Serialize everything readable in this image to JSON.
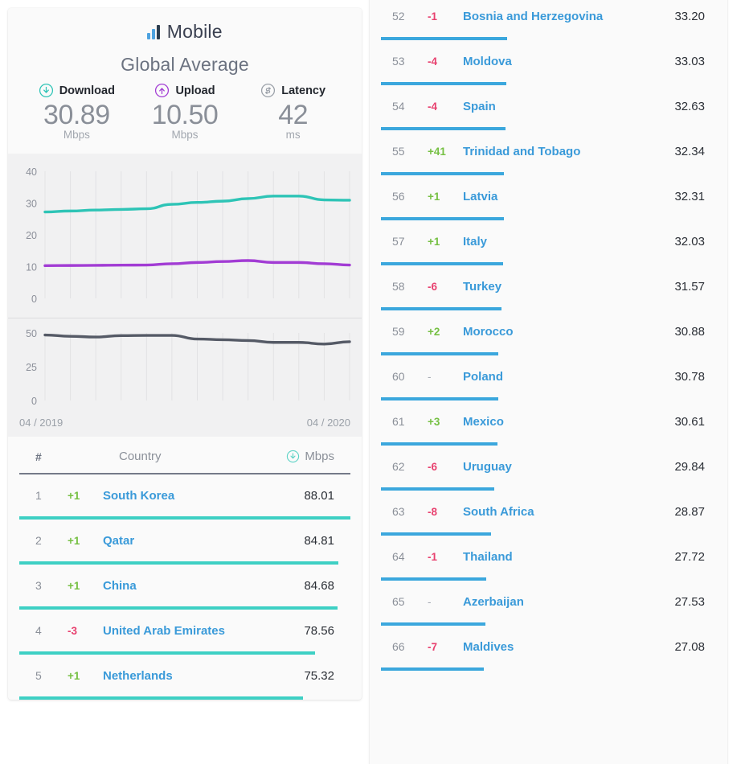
{
  "card": {
    "title": "Mobile",
    "title_icon": "bar-chart-icon",
    "subtitle": "Global Average",
    "metrics": [
      {
        "icon": "download-circle-icon",
        "name": "Download",
        "value": "30.89",
        "unit": "Mbps",
        "color": "#2ec4b6"
      },
      {
        "icon": "upload-circle-icon",
        "name": "Upload",
        "value": "10.50",
        "unit": "Mbps",
        "color": "#a23cd4"
      },
      {
        "icon": "latency-circle-icon",
        "name": "Latency",
        "value": "42",
        "unit": "ms",
        "color": "#8c909a"
      }
    ],
    "date_start": "04 / 2019",
    "date_end": "04 / 2020"
  },
  "chart_data": [
    {
      "type": "line",
      "title": "Global Average Speed",
      "xlabel": "",
      "ylabel": "Mbps",
      "ylim": [
        0,
        40
      ],
      "yticks": [
        0,
        10,
        20,
        30,
        40
      ],
      "grid": true,
      "legend": "none",
      "x": [
        "04/2019",
        "05/2019",
        "06/2019",
        "07/2019",
        "08/2019",
        "09/2019",
        "10/2019",
        "11/2019",
        "12/2019",
        "01/2020",
        "02/2020",
        "03/2020",
        "04/2020"
      ],
      "series": [
        {
          "name": "Download",
          "color": "#2ec4b6",
          "values": [
            27.2,
            27.5,
            27.8,
            28.0,
            28.2,
            29.6,
            30.2,
            30.6,
            31.4,
            32.2,
            32.2,
            31.0,
            30.89
          ]
        },
        {
          "name": "Upload",
          "color": "#a23cd4",
          "values": [
            10.3,
            10.35,
            10.4,
            10.45,
            10.5,
            10.9,
            11.3,
            11.6,
            11.9,
            11.3,
            11.3,
            10.9,
            10.5
          ]
        }
      ]
    },
    {
      "type": "line",
      "title": "Global Average Latency",
      "xlabel": "",
      "ylabel": "ms",
      "ylim": [
        0,
        50
      ],
      "yticks": [
        0,
        25,
        50
      ],
      "grid": true,
      "legend": "none",
      "x": [
        "04/2019",
        "05/2019",
        "06/2019",
        "07/2019",
        "08/2019",
        "09/2019",
        "10/2019",
        "11/2019",
        "12/2019",
        "01/2020",
        "02/2020",
        "03/2020",
        "04/2020"
      ],
      "series": [
        {
          "name": "Latency",
          "color": "#555a66",
          "values": [
            48.5,
            47.5,
            47.0,
            48.0,
            48.2,
            48.2,
            45.5,
            45.0,
            44.4,
            43.0,
            43.0,
            41.8,
            43.5
          ]
        }
      ]
    }
  ],
  "table": {
    "header": {
      "rank": "#",
      "country": "Country",
      "unit": "Mbps",
      "unit_icon": "download-circle-icon"
    },
    "bar_color_left": "#3ed0c4",
    "bar_color_right": "#3ba7dd",
    "max_value": 88.01,
    "rows_left": [
      {
        "rank": "1",
        "delta": "+1",
        "delta_dir": "up",
        "country": "South Korea",
        "value": "88.01"
      },
      {
        "rank": "2",
        "delta": "+1",
        "delta_dir": "up",
        "country": "Qatar",
        "value": "84.81"
      },
      {
        "rank": "3",
        "delta": "+1",
        "delta_dir": "up",
        "country": "China",
        "value": "84.68"
      },
      {
        "rank": "4",
        "delta": "-3",
        "delta_dir": "down",
        "country": "United Arab Emirates",
        "value": "78.56"
      },
      {
        "rank": "5",
        "delta": "+1",
        "delta_dir": "up",
        "country": "Netherlands",
        "value": "75.32"
      }
    ],
    "rows_right": [
      {
        "rank": "52",
        "delta": "-1",
        "delta_dir": "down",
        "country": "Bosnia and Herzegovina",
        "value": "33.20"
      },
      {
        "rank": "53",
        "delta": "-4",
        "delta_dir": "down",
        "country": "Moldova",
        "value": "33.03"
      },
      {
        "rank": "54",
        "delta": "-4",
        "delta_dir": "down",
        "country": "Spain",
        "value": "32.63"
      },
      {
        "rank": "55",
        "delta": "+41",
        "delta_dir": "up",
        "country": "Trinidad and Tobago",
        "value": "32.34"
      },
      {
        "rank": "56",
        "delta": "+1",
        "delta_dir": "up",
        "country": "Latvia",
        "value": "32.31"
      },
      {
        "rank": "57",
        "delta": "+1",
        "delta_dir": "up",
        "country": "Italy",
        "value": "32.03"
      },
      {
        "rank": "58",
        "delta": "-6",
        "delta_dir": "down",
        "country": "Turkey",
        "value": "31.57"
      },
      {
        "rank": "59",
        "delta": "+2",
        "delta_dir": "up",
        "country": "Morocco",
        "value": "30.88"
      },
      {
        "rank": "60",
        "delta": "-",
        "delta_dir": "flat",
        "country": "Poland",
        "value": "30.78"
      },
      {
        "rank": "61",
        "delta": "+3",
        "delta_dir": "up",
        "country": "Mexico",
        "value": "30.61"
      },
      {
        "rank": "62",
        "delta": "-6",
        "delta_dir": "down",
        "country": "Uruguay",
        "value": "29.84"
      },
      {
        "rank": "63",
        "delta": "-8",
        "delta_dir": "down",
        "country": "South Africa",
        "value": "28.87"
      },
      {
        "rank": "64",
        "delta": "-1",
        "delta_dir": "down",
        "country": "Thailand",
        "value": "27.72"
      },
      {
        "rank": "65",
        "delta": "-",
        "delta_dir": "flat",
        "country": "Azerbaijan",
        "value": "27.53"
      },
      {
        "rank": "66",
        "delta": "-7",
        "delta_dir": "down",
        "country": "Maldives",
        "value": "27.08"
      }
    ]
  }
}
